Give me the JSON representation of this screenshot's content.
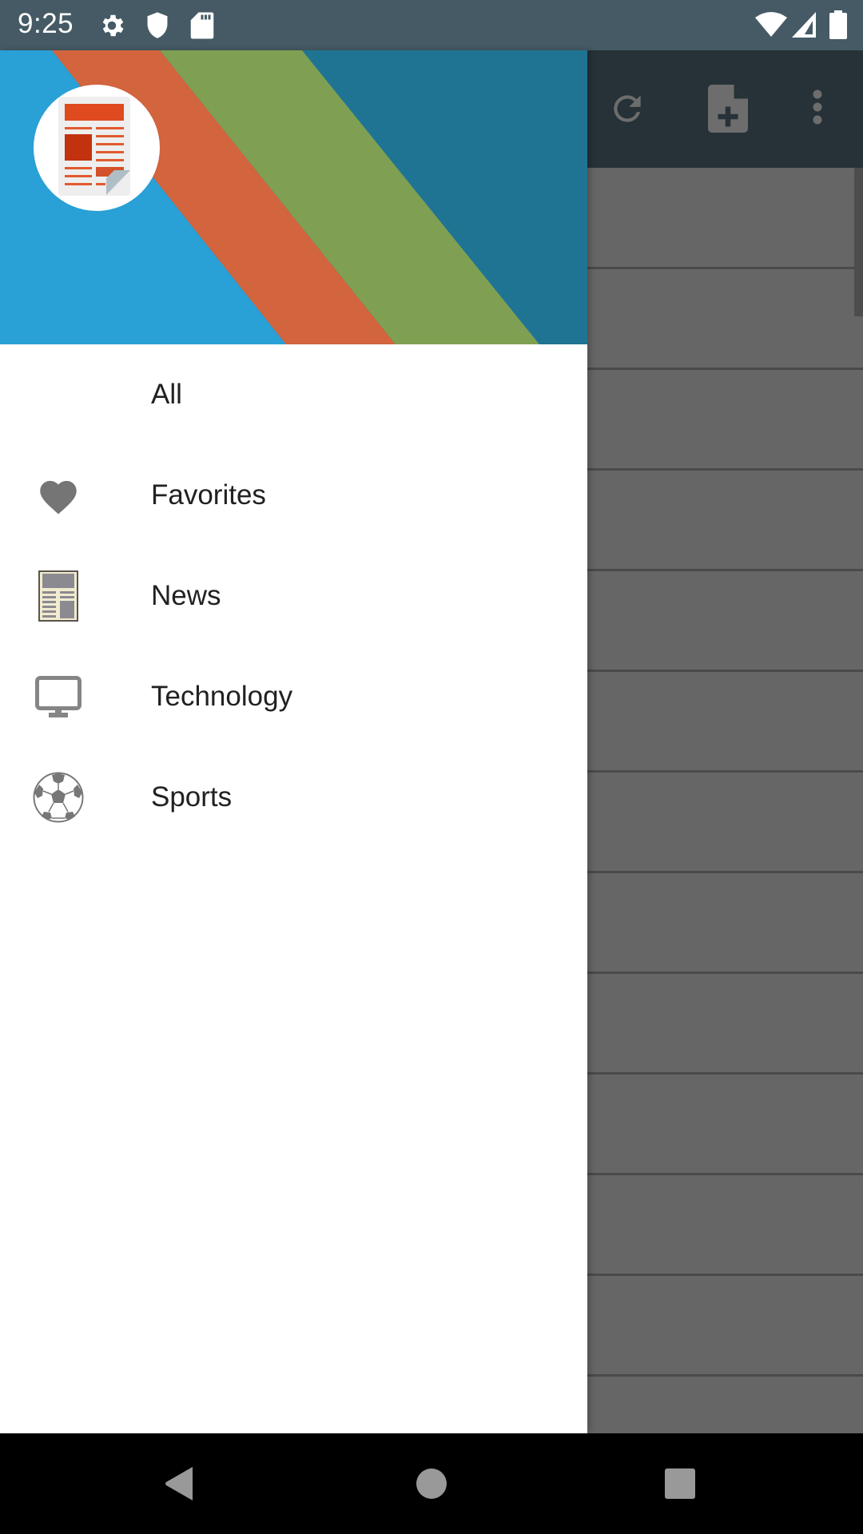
{
  "status_bar": {
    "time": "9:25",
    "left_icons": [
      "settings-icon",
      "shield-icon",
      "sd-card-icon"
    ],
    "right_icons": [
      "wifi-icon",
      "cell-signal-icon",
      "battery-icon"
    ]
  },
  "toolbar": {
    "actions": [
      {
        "name": "refresh-icon",
        "label": "Refresh"
      },
      {
        "name": "add-document-icon",
        "label": "Add feed"
      },
      {
        "name": "more-options-icon",
        "label": "More options"
      }
    ]
  },
  "drawer": {
    "header": {
      "logo": "newspaper-logo-icon",
      "colors": {
        "blue": "#29a0d6",
        "orange": "#d2643e",
        "green": "#7fa052",
        "dark_blue": "#1f7494"
      }
    },
    "items": [
      {
        "label": "All",
        "icon": null
      },
      {
        "label": "Favorites",
        "icon": "heart-icon"
      },
      {
        "label": "News",
        "icon": "newspaper-icon"
      },
      {
        "label": "Technology",
        "icon": "monitor-icon"
      },
      {
        "label": "Sports",
        "icon": "soccer-ball-icon"
      }
    ]
  },
  "nav_bar": {
    "buttons": [
      "back-button",
      "home-button",
      "recents-button"
    ]
  },
  "colors": {
    "status_bar": "#455a64",
    "toolbar_dimmed": "#263238",
    "list_dimmed": "#666666",
    "icon_gray": "#757575",
    "text": "#212121"
  }
}
